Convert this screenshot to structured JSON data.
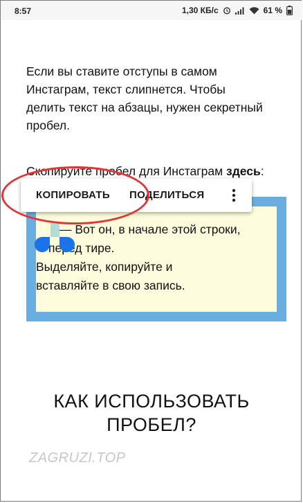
{
  "status_bar": {
    "time": "8:57",
    "network_speed": "1,30 КБ/с",
    "battery": "61 %",
    "icons": [
      "alarm-icon",
      "signal-icon",
      "wifi-icon",
      "battery-icon"
    ]
  },
  "article": {
    "paragraph_lines": [
      "Если вы ставите отступы в самом",
      "Инстаграм, текст слипнется. Чтобы",
      "делить текст на абзацы, нужен секретный",
      "пробел."
    ],
    "copy_prompt": "Скопируйте пробел для Инстаграм ",
    "copy_prompt_bold": "здесь",
    "copy_prompt_end": ":"
  },
  "context_menu": {
    "copy_label": "КОПИРОВАТЬ",
    "share_label": "ПОДЕЛИТЬСЯ",
    "more_icon": "more-vertical-icon"
  },
  "space_box": {
    "lines": [
      "— Вот он, в начале этой строки,",
      "перед тире.",
      "Выделяйте, копируйте и",
      "вставляйте в свою запись."
    ]
  },
  "heading": {
    "line1": "КАК ИСПОЛЬЗОВАТЬ",
    "line2": "ПРОБЕЛ?"
  },
  "watermark": "ZAGRUZI.TOP",
  "colors": {
    "box_border": "#6aaee0",
    "box_fill": "#fdfcdc",
    "highlight": "#e23636",
    "handle": "#1a73e8",
    "selection": "#b2dcd8"
  }
}
